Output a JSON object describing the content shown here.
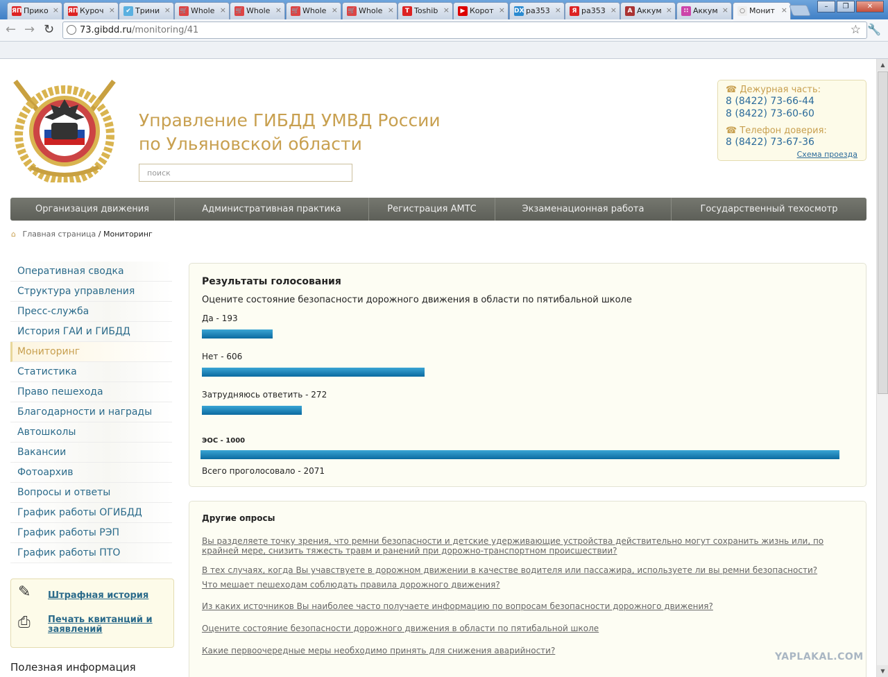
{
  "browser": {
    "tabs": [
      {
        "label": "Прико",
        "icon": "ЯП",
        "icon_bg": "#d22",
        "active": false
      },
      {
        "label": "Куроч",
        "icon": "ЯП",
        "icon_bg": "#d22",
        "active": false
      },
      {
        "label": "Трини",
        "icon": "bird",
        "icon_bg": "#5ab0e0",
        "active": false
      },
      {
        "label": "Whole",
        "icon": "cart",
        "icon_bg": "#d44",
        "active": false
      },
      {
        "label": "Whole",
        "icon": "cart",
        "icon_bg": "#d44",
        "active": false
      },
      {
        "label": "Whole",
        "icon": "cart",
        "icon_bg": "#d44",
        "active": false
      },
      {
        "label": "Whole",
        "icon": "cart",
        "icon_bg": "#d44",
        "active": false
      },
      {
        "label": "Toshib",
        "icon": "T",
        "icon_bg": "#d22",
        "active": false
      },
      {
        "label": "Корот",
        "icon": "play",
        "icon_bg": "#d00",
        "active": false
      },
      {
        "label": "ра353",
        "icon": "DX",
        "icon_bg": "#2a8ad0",
        "active": false
      },
      {
        "label": "ра353",
        "icon": "Я",
        "icon_bg": "#d22",
        "active": false
      },
      {
        "label": "Аккум",
        "icon": "A",
        "icon_bg": "#a33",
        "active": false
      },
      {
        "label": "Аккум",
        "icon": "dots",
        "icon_bg": "#c4a",
        "active": false
      },
      {
        "label": "Монит",
        "icon": "globe",
        "icon_bg": "#eee",
        "active": true
      }
    ],
    "url_domain": "73.gibdd.ru",
    "url_path": "/monitoring/41"
  },
  "header": {
    "title_line1": "Управление ГИБДД УМВД России",
    "title_line2": "по Ульяновской области",
    "search_placeholder": "поиск"
  },
  "contacts": {
    "duty_label": "Дежурная часть:",
    "duty_phone1": "8 (8422) 73-66-44",
    "duty_phone2": "8 (8422) 73-60-60",
    "trust_label": "Телефон доверия:",
    "trust_phone": "8 (8422) 73-67-36",
    "map_link": "Схема проезда"
  },
  "nav": [
    "Организация движения",
    "Административная практика",
    "Регистрация АМТС",
    "Экзаменационная работа",
    "Государственный техосмотр"
  ],
  "breadcrumb": {
    "home": "Главная страница",
    "sep": "/",
    "current": "Мониторинг"
  },
  "sidebar": [
    "Оперативная сводка",
    "Структура управления",
    "Пресс-служба",
    "История ГАИ и ГИБДД",
    "Мониторинг",
    "Статистика",
    "Право пешехода",
    "Благодарности и награды",
    "Автошколы",
    "Вакансии",
    "Фотоархив",
    "Вопросы и ответы",
    "График работы ОГИБДД",
    "График работы РЭП",
    "График работы ПТО"
  ],
  "sidebar_active_index": 4,
  "tools": {
    "fine_history": "Штрафная история",
    "print_receipts": "Печать квитанций и заявлений"
  },
  "useful_info": "Полезная информация",
  "poll": {
    "heading": "Результаты голосования",
    "question": "Оцените состояние безопасности дорожного движения в области по пятибальной школе",
    "bar_color": "#1b84bb",
    "answers": [
      {
        "label": "Да - 193",
        "votes": 193
      },
      {
        "label": "Нет - 606",
        "votes": 606
      },
      {
        "label": "Затрудняюсь ответить - 272",
        "votes": 272
      }
    ],
    "extra": {
      "label": "ЭОС - 1000",
      "votes": 1000
    },
    "total": "Всего проголосовало - 2071"
  },
  "other_polls": {
    "heading": "Другие опросы",
    "items": [
      "Вы разделяете точку зрения, что ремни безопасности и детские удерживающие устройства действительно могут сохранить жизнь или, по крайней мере, снизить тяжесть травм и ранений при дорожно-транспортном происшествии?",
      "В тех случаях, когда Вы учавствуете в дорожном движении в качестве водителя или пассажира, используете ли вы ремни безопасности?",
      "Что мешает пешеходам соблюдать правила дорожного движения?",
      "Из каких источников Вы наиболее часто получаете информацию по вопросам безопасности дорожного движения?",
      "Оцените состояние безопасности дорожного движения в области по пятибальной школе",
      "Какие первоочередные меры необходимо принять для снижения аварийности?"
    ]
  },
  "watermark": "YAPLAKAL.COM"
}
